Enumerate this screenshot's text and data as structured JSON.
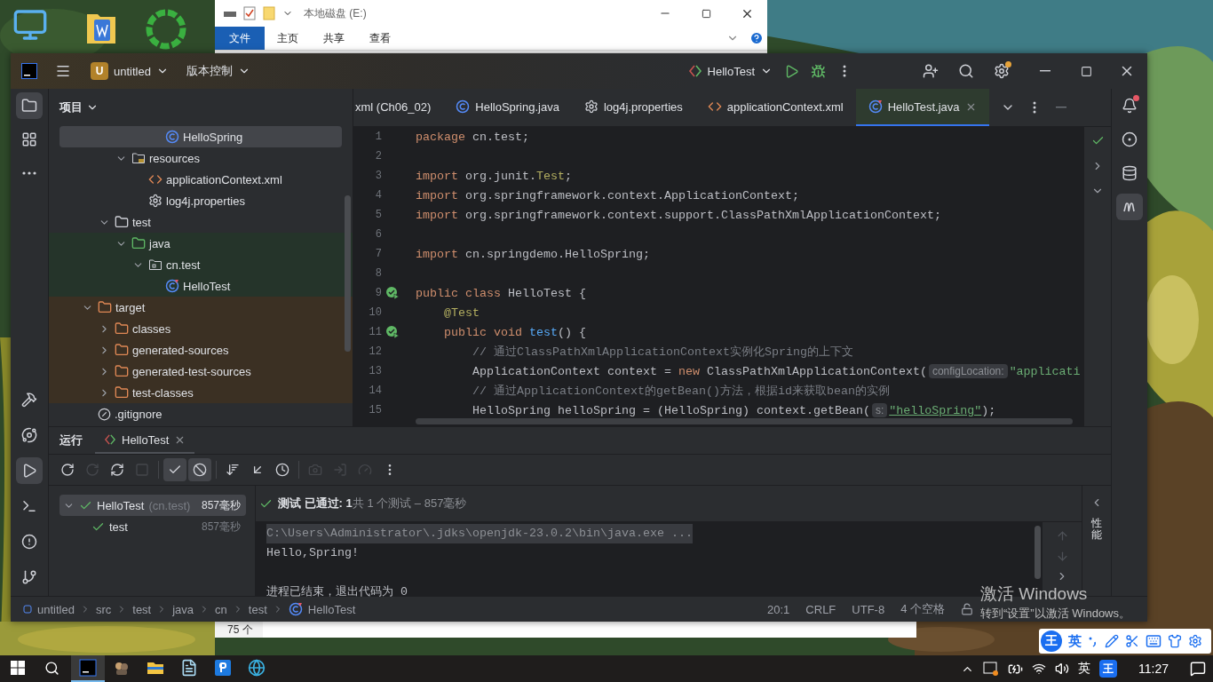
{
  "explorer": {
    "title": "本地磁盘 (E:)",
    "ribbon_tabs": [
      {
        "label": "文件",
        "selected": true
      },
      {
        "label": "主页",
        "selected": false
      },
      {
        "label": "共享",
        "selected": false
      },
      {
        "label": "查看",
        "selected": false
      }
    ]
  },
  "back_window": {
    "status": "75 个"
  },
  "ide": {
    "project": {
      "initial": "U",
      "name": "untitled"
    },
    "vcs": "版本控制",
    "run_config": "HelloTest",
    "left_tools": [
      {
        "kind": "project",
        "selected": true
      },
      {
        "kind": "structure",
        "selected": false
      },
      {
        "kind": "more",
        "selected": false
      }
    ],
    "left_tools_bottom": [
      {
        "kind": "build",
        "selected": false
      },
      {
        "kind": "services",
        "selected": false
      },
      {
        "kind": "run",
        "selected": true
      },
      {
        "kind": "terminal",
        "selected": false
      },
      {
        "kind": "problems",
        "selected": false
      },
      {
        "kind": "git",
        "selected": false
      }
    ],
    "right_tools": [
      {
        "kind": "notifications",
        "selected": false
      },
      {
        "kind": "assistant",
        "selected": false
      },
      {
        "kind": "database",
        "selected": false
      },
      {
        "kind": "maven",
        "selected": true
      }
    ],
    "project_panel": {
      "title": "项目",
      "tree": [
        {
          "label": "HelloSpring",
          "kind": "class",
          "selected": true
        },
        {
          "label": "resources",
          "kind": "resources",
          "selected": false,
          "expanded": true,
          "children": [
            {
              "label": "applicationContext.xml",
              "kind": "xml",
              "selected": false
            },
            {
              "label": "log4j.properties",
              "kind": "properties",
              "selected": false
            }
          ]
        },
        {
          "label": "test",
          "kind": "folder",
          "selected": false,
          "expanded": true,
          "children": [
            {
              "label": "java",
              "kind": "test-folder",
              "test_root": true,
              "selected": false,
              "expanded": true,
              "children": [
                {
                  "label": "cn.test",
                  "kind": "package",
                  "selected": false,
                  "expanded": true,
                  "children": [
                    {
                      "label": "HelloTest",
                      "kind": "test-class",
                      "selected": false
                    }
                  ]
                }
              ]
            }
          ]
        },
        {
          "label": "target",
          "kind": "excluded-folder",
          "excluded": true,
          "selected": false,
          "expanded": true,
          "children": [
            {
              "label": "classes",
              "kind": "excluded-folder",
              "selected": false,
              "expanded": false
            },
            {
              "label": "generated-sources",
              "kind": "excluded-folder",
              "selected": false,
              "expanded": false
            },
            {
              "label": "generated-test-sources",
              "kind": "excluded-folder",
              "selected": false,
              "expanded": false
            },
            {
              "label": "test-classes",
              "kind": "excluded-folder",
              "selected": false,
              "expanded": false
            }
          ]
        },
        {
          "label": ".gitignore",
          "kind": "ignore",
          "selected": false
        }
      ]
    },
    "editor_tabs": [
      {
        "label": "xml (Ch06_02)",
        "kind": "plain",
        "selected": false
      },
      {
        "label": "HelloSpring.java",
        "kind": "class",
        "selected": false
      },
      {
        "label": "log4j.properties",
        "kind": "properties",
        "selected": false
      },
      {
        "label": "applicationContext.xml",
        "kind": "xml",
        "selected": false
      },
      {
        "label": "HelloTest.java",
        "kind": "test-class",
        "selected": true
      }
    ],
    "code": [
      {
        "number": "1",
        "run_marker": false,
        "tokens": [
          {
            "kind": "keyword",
            "text": "package"
          },
          {
            "kind": "plain",
            "text": " cn.test;"
          }
        ]
      },
      {
        "number": "2",
        "run_marker": false
      },
      {
        "number": "3",
        "run_marker": false,
        "tokens": [
          {
            "kind": "keyword",
            "text": "import"
          },
          {
            "kind": "plain",
            "text": " org.junit."
          },
          {
            "kind": "annotation",
            "text": "Test"
          },
          {
            "kind": "plain",
            "text": ";"
          }
        ]
      },
      {
        "number": "4",
        "run_marker": false,
        "tokens": [
          {
            "kind": "keyword",
            "text": "import"
          },
          {
            "kind": "plain",
            "text": " org.springframework.context.ApplicationContext;"
          }
        ]
      },
      {
        "number": "5",
        "run_marker": false,
        "tokens": [
          {
            "kind": "keyword",
            "text": "import"
          },
          {
            "kind": "plain",
            "text": " org.springframework.context.support.ClassPathXmlApplicationContext;"
          }
        ]
      },
      {
        "number": "6",
        "run_marker": false
      },
      {
        "number": "7",
        "run_marker": false,
        "tokens": [
          {
            "kind": "keyword",
            "text": "import"
          },
          {
            "kind": "plain",
            "text": " cn.springdemo.HelloSpring;"
          }
        ]
      },
      {
        "number": "8",
        "run_marker": false
      },
      {
        "number": "9",
        "run_marker": true,
        "tokens": [
          {
            "kind": "keyword",
            "text": "public class"
          },
          {
            "kind": "plain",
            "text": " HelloTest {"
          }
        ]
      },
      {
        "number": "10",
        "run_marker": false,
        "tokens": [
          {
            "kind": "annotation",
            "text": "    @Test"
          }
        ]
      },
      {
        "number": "11",
        "run_marker": true,
        "tokens": [
          {
            "kind": "keyword",
            "text": "    public void"
          },
          {
            "kind": "function",
            "text": " test"
          },
          {
            "kind": "plain",
            "text": "() {"
          }
        ]
      },
      {
        "number": "12",
        "run_marker": false,
        "tokens": [
          {
            "kind": "comment",
            "text": "        // 通过ClassPathXmlApplicationContext实例化Spring的上下文"
          }
        ]
      },
      {
        "number": "13",
        "run_marker": false,
        "tokens": [
          {
            "kind": "plain",
            "text": "        ApplicationContext context = "
          },
          {
            "kind": "keyword",
            "text": "new"
          },
          {
            "kind": "plain",
            "text": " ClassPathXmlApplicationContext("
          },
          {
            "kind": "hint",
            "text": "configLocation:"
          },
          {
            "kind": "string",
            "text": "\"applicati"
          }
        ]
      },
      {
        "number": "14",
        "run_marker": false,
        "tokens": [
          {
            "kind": "comment",
            "text": "        // 通过ApplicationContext的getBean()方法，根据id来获取bean的实例"
          }
        ]
      },
      {
        "number": "15",
        "run_marker": false,
        "tokens": [
          {
            "kind": "plain",
            "text": "        HelloSpring helloSpring = (HelloSpring) context.getBean("
          },
          {
            "kind": "hint",
            "text": "s:"
          },
          {
            "kind": "string",
            "text": "\"helloSpring\""
          },
          {
            "kind": "plain",
            "text": ");"
          }
        ]
      }
    ],
    "run_panel": {
      "title": "运行",
      "tabs": [
        {
          "label": "HelloTest",
          "selected": true
        }
      ],
      "toolbar": [
        {
          "kind": "rerun",
          "disabled": false,
          "on": false
        },
        {
          "kind": "rerun-failed",
          "disabled": true,
          "on": false
        },
        {
          "kind": "auto-rerun",
          "disabled": false,
          "on": false
        },
        {
          "kind": "stop",
          "disabled": true,
          "on": false
        },
        {
          "kind": "show-passed",
          "disabled": false,
          "on": true
        },
        {
          "kind": "show-ignored",
          "disabled": false,
          "on": true
        },
        {
          "kind": "sort",
          "disabled": false,
          "on": false
        },
        {
          "kind": "collapse",
          "disabled": false,
          "on": false
        },
        {
          "kind": "history",
          "disabled": false,
          "on": false
        },
        {
          "kind": "snapshot",
          "disabled": true,
          "on": false
        },
        {
          "kind": "import",
          "disabled": true,
          "on": false
        },
        {
          "kind": "profile",
          "disabled": true,
          "on": false
        },
        {
          "kind": "more",
          "disabled": false,
          "on": false
        }
      ],
      "results": [
        {
          "name": "HelloTest",
          "package": "(cn.test)",
          "time": "857毫秒",
          "selected": true,
          "expanded": true,
          "children": [
            {
              "name": "test",
              "time": "857毫秒",
              "selected": false
            }
          ]
        }
      ],
      "summary": "**测试 已通过: 1**共 1 个测试 – 857毫秒",
      "console": [
        {
          "kind": "command",
          "text": "C:\\Users\\Administrator\\.jdks\\openjdk-23.0.2\\bin\\java.exe ..."
        },
        {
          "kind": "output",
          "text": "Hello,Spring!"
        },
        {
          "kind": "exit",
          "text": "进程已结束，退出代码为 0"
        }
      ],
      "side_tab": "性能"
    },
    "breadcrumbs": [
      "untitled",
      "src",
      "test",
      "java",
      "cn",
      "test",
      "HelloTest"
    ],
    "status": {
      "position": "20:1",
      "line_ending": "CRLF",
      "encoding": "UTF-8",
      "indent": "4 个空格"
    }
  },
  "activation": {
    "title": "激活 Windows",
    "subtitle": "转到“设置”以激活 Windows。"
  },
  "ime_bar": {
    "logo": "王",
    "mode": "英"
  },
  "taskbar": {
    "apps": [
      {
        "kind": "intellij",
        "selected": true
      },
      {
        "kind": "figure-app",
        "selected": false
      },
      {
        "kind": "explorer",
        "selected": false
      },
      {
        "kind": "notepad",
        "selected": false
      },
      {
        "kind": "p-app",
        "selected": false
      },
      {
        "kind": "edge",
        "selected": false
      }
    ],
    "lang": "英",
    "ime_logo": "王",
    "time": "11:27"
  }
}
